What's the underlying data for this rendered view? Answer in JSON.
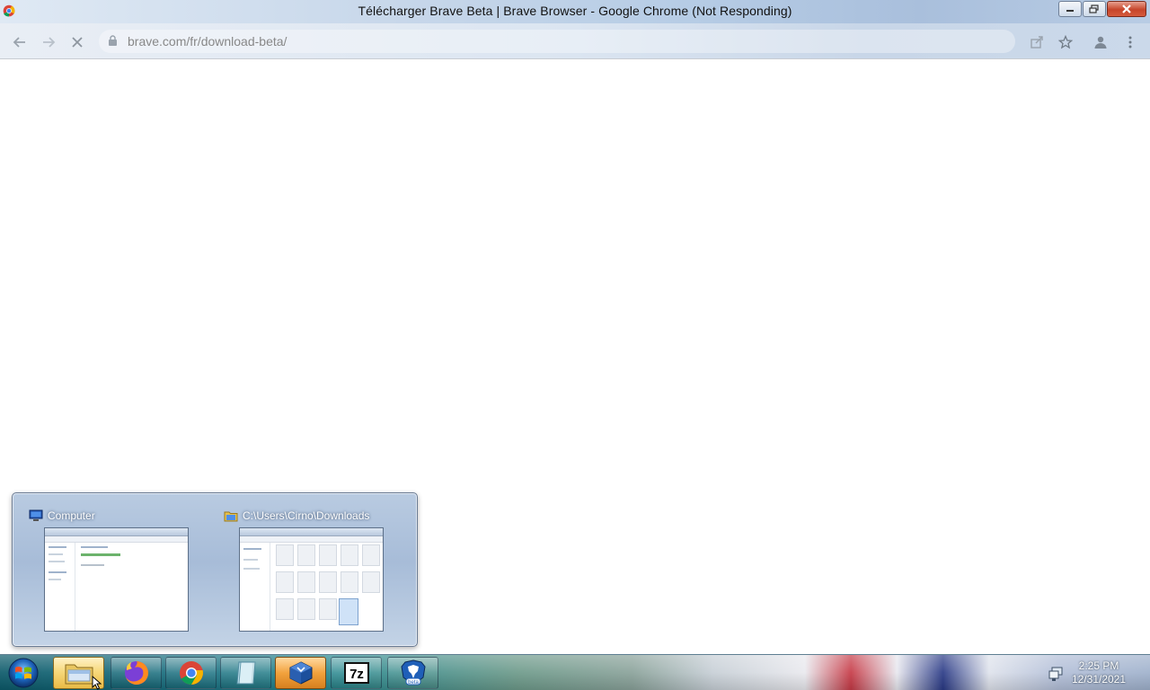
{
  "window": {
    "title": "Télécharger Brave Beta | Brave Browser - Google Chrome (Not Responding)"
  },
  "toolbar": {
    "url": "brave.com/fr/download-beta/"
  },
  "taskbar_popup": {
    "thumbnails": [
      {
        "label": "Computer",
        "icon": "computer-icon"
      },
      {
        "label": "C:\\Users\\Cirno\\Downloads",
        "icon": "folder-icon"
      }
    ]
  },
  "taskbar": {
    "apps": [
      {
        "name": "windows-explorer",
        "icon": "folder-icon",
        "active": true
      },
      {
        "name": "firefox",
        "icon": "firefox-icon",
        "active": false
      },
      {
        "name": "google-chrome",
        "icon": "chrome-icon",
        "active": false
      },
      {
        "name": "notepad-app",
        "icon": "document-icon",
        "active": false
      },
      {
        "name": "virtualbox",
        "icon": "virtualbox-icon",
        "active": false
      },
      {
        "name": "7-zip",
        "icon": "7zip-icon",
        "active": false,
        "text": "7z"
      },
      {
        "name": "brave-beta",
        "icon": "brave-beta-icon",
        "active": false,
        "text": "beta"
      }
    ],
    "clock": {
      "time": "2:25 PM",
      "date": "12/31/2021"
    }
  }
}
